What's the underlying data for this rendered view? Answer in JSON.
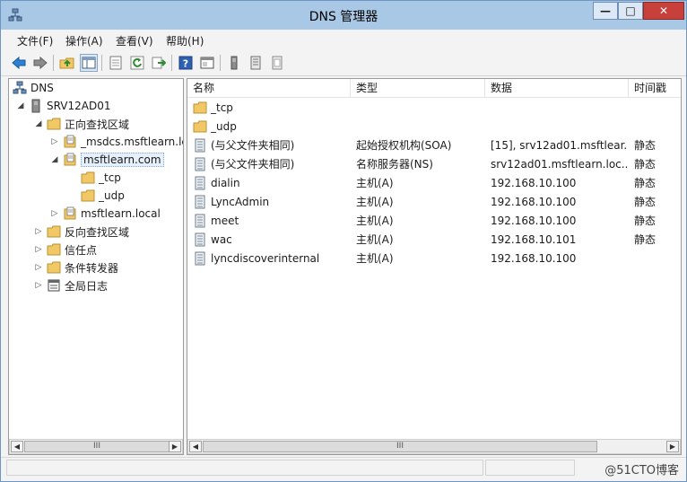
{
  "window": {
    "title": "DNS 管理器"
  },
  "menu": [
    "文件(F)",
    "操作(A)",
    "查看(V)",
    "帮助(H)"
  ],
  "toolbar": {
    "buttons": [
      "back-arrow-icon",
      "forward-arrow-icon",
      "up-folder-icon",
      "show-tree-icon",
      "properties-icon",
      "refresh-icon",
      "export-list-icon",
      "help-icon",
      "show-hide-pane-icon",
      "server-icon",
      "record-icon",
      "zone-icon"
    ]
  },
  "tree": [
    {
      "label": "DNS",
      "icon": "dns-icon",
      "expander": ""
    },
    {
      "label": "SRV12AD01",
      "icon": "server-icon",
      "expander": "expanded"
    },
    {
      "label": "正向查找区域",
      "icon": "folder-icon",
      "expander": "expanded"
    },
    {
      "label": "_msdcs.msftlearn.lc",
      "icon": "zone-icon",
      "expander": "collapsed"
    },
    {
      "label": "msftlearn.com",
      "icon": "zone-icon",
      "expander": "expanded",
      "selected": true
    },
    {
      "label": "_tcp",
      "icon": "folder-icon",
      "expander": ""
    },
    {
      "label": "_udp",
      "icon": "folder-icon",
      "expander": ""
    },
    {
      "label": "msftlearn.local",
      "icon": "zone-icon",
      "expander": "collapsed"
    },
    {
      "label": "反向查找区域",
      "icon": "folder-icon",
      "expander": "collapsed"
    },
    {
      "label": "信任点",
      "icon": "folder-icon",
      "expander": "collapsed"
    },
    {
      "label": "条件转发器",
      "icon": "folder-icon",
      "expander": "collapsed"
    },
    {
      "label": "全局日志",
      "icon": "log-icon",
      "expander": "collapsed"
    }
  ],
  "list": {
    "columns": [
      "名称",
      "类型",
      "数据",
      "时间戳"
    ],
    "rows": [
      {
        "icon": "folder-icon",
        "name": "_tcp",
        "type": "",
        "data": "",
        "timestamp": ""
      },
      {
        "icon": "folder-icon",
        "name": "_udp",
        "type": "",
        "data": "",
        "timestamp": ""
      },
      {
        "icon": "record-icon",
        "name": "(与父文件夹相同)",
        "type": "起始授权机构(SOA)",
        "data": "[15], srv12ad01.msftlear...",
        "timestamp": "静态"
      },
      {
        "icon": "record-icon",
        "name": "(与父文件夹相同)",
        "type": "名称服务器(NS)",
        "data": "srv12ad01.msftlearn.loc...",
        "timestamp": "静态"
      },
      {
        "icon": "record-icon",
        "name": "dialin",
        "type": "主机(A)",
        "data": "192.168.10.100",
        "timestamp": "静态"
      },
      {
        "icon": "record-icon",
        "name": "LyncAdmin",
        "type": "主机(A)",
        "data": "192.168.10.100",
        "timestamp": "静态"
      },
      {
        "icon": "record-icon",
        "name": "meet",
        "type": "主机(A)",
        "data": "192.168.10.100",
        "timestamp": "静态"
      },
      {
        "icon": "record-icon",
        "name": "wac",
        "type": "主机(A)",
        "data": "192.168.10.101",
        "timestamp": "静态"
      },
      {
        "icon": "record-icon",
        "name": "lyncdiscoverinternal",
        "type": "主机(A)",
        "data": "192.168.10.100",
        "timestamp": ""
      }
    ]
  },
  "scroll": {
    "thumb_label": "III"
  },
  "status": {
    "watermark": "@51CTO博客"
  },
  "colors": {
    "titlebar": "#a9c8e6",
    "close": "#c7403a",
    "folder": "#f2c766"
  }
}
